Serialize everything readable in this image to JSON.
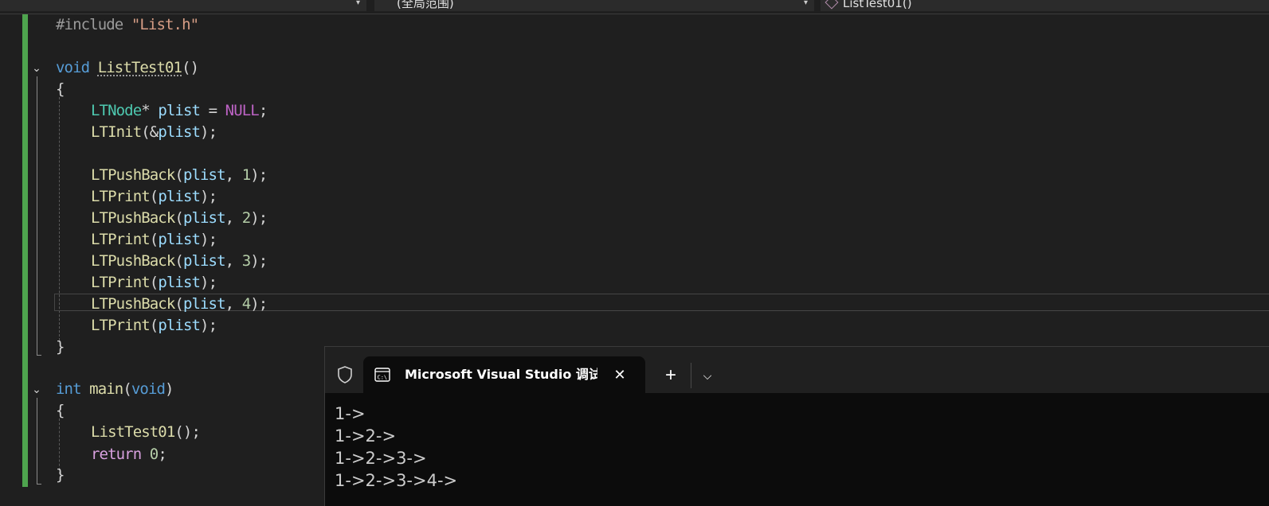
{
  "navbar": {
    "scope": "(全局范围)",
    "function": "ListTest01()"
  },
  "code": {
    "include_directive": "#include",
    "include_file": "\"List.h\"",
    "fn_void": "void",
    "fn_name": "ListTest01",
    "parens_empty": "()",
    "brace_open": "{",
    "brace_close": "}",
    "type_ltnode": "LTNode",
    "star": "*",
    "var_plist": "plist",
    "assign": " = ",
    "null": "NULL",
    "semicolon": ";",
    "fn_init": "LTInit",
    "paren_open": "(",
    "paren_close": ")",
    "amp": "&",
    "fn_pushback": "LTPushBack",
    "comma": ", ",
    "close_stmt": ");",
    "fn_print": "LTPrint",
    "num1": "1",
    "num2": "2",
    "num3": "3",
    "num4": "4",
    "kw_int": "int",
    "fn_main": "main",
    "kw_void_param": "void",
    "call_stmt": "();",
    "kw_return": "return",
    "num0": "0"
  },
  "terminal": {
    "tab_title": "Microsoft Visual Studio 调试控制台",
    "close_glyph": "✕",
    "new_tab_glyph": "+",
    "dropdown_glyph": "⌵",
    "output": [
      "1->",
      "1->2->",
      "1->2->3->",
      "1->2->3->4->"
    ]
  },
  "icons": {
    "fold_expanded": "⌄",
    "nav_chevron": "▾"
  }
}
